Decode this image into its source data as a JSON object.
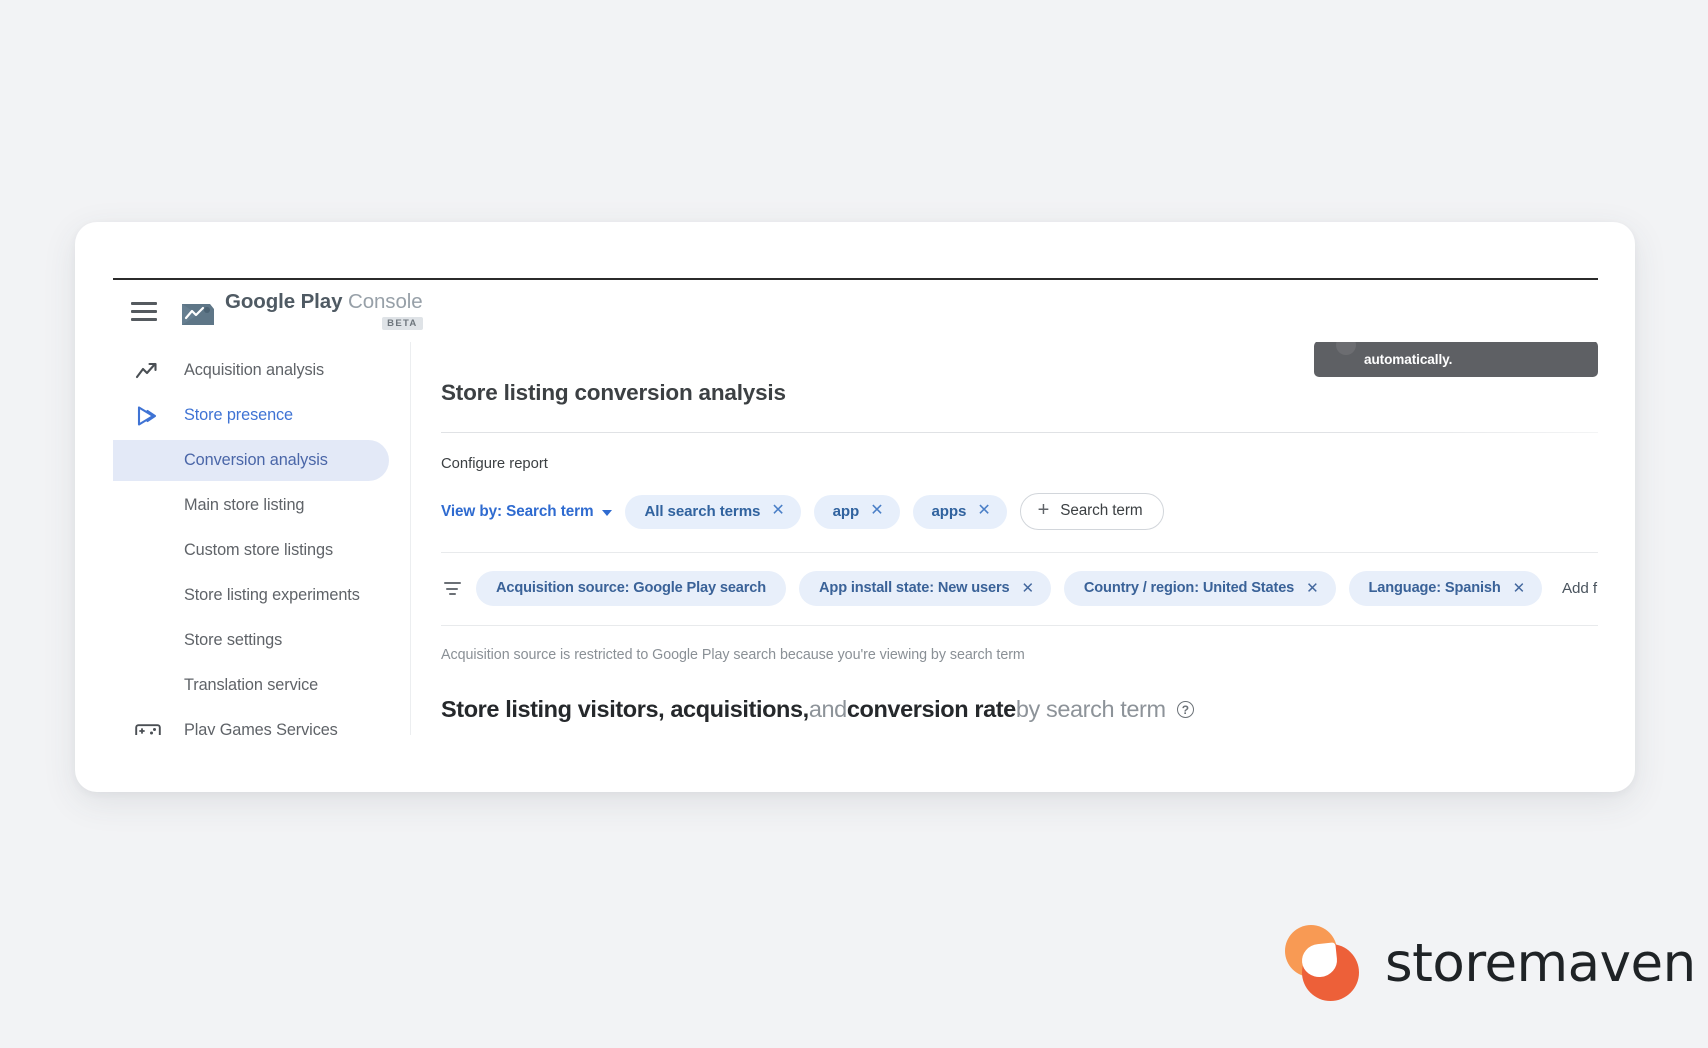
{
  "appbar": {
    "menu_icon": "hamburger-menu-icon",
    "logo_icon": "google-play-console-logo-icon",
    "brand_primary": "Google Play",
    "brand_secondary": "Console",
    "beta_badge": "BETA"
  },
  "sidebar": {
    "items": [
      {
        "label": "Acquisition analysis",
        "icon": "trend-up-icon",
        "type": "item",
        "active": false
      },
      {
        "label": "Store presence",
        "icon": "play-triangle-icon",
        "type": "section",
        "active": false
      },
      {
        "label": "Conversion analysis",
        "type": "sub",
        "active": true
      },
      {
        "label": "Main store listing",
        "type": "sub",
        "active": false
      },
      {
        "label": "Custom store listings",
        "type": "sub",
        "active": false
      },
      {
        "label": "Store listing experiments",
        "type": "sub",
        "active": false
      },
      {
        "label": "Store settings",
        "type": "sub",
        "active": false
      },
      {
        "label": "Translation service",
        "type": "sub",
        "active": false
      },
      {
        "label": "Play Games Services",
        "icon": "gamepad-icon",
        "type": "item",
        "active": false
      }
    ]
  },
  "main": {
    "page_title": "Store listing conversion analysis",
    "section_label": "Configure report",
    "view_by": {
      "label": "View by: Search term",
      "caret_icon": "chevron-down-icon"
    },
    "term_chips": [
      {
        "label": "All search terms",
        "remove_icon": "close-icon"
      },
      {
        "label": "app",
        "remove_icon": "close-icon"
      },
      {
        "label": "apps",
        "remove_icon": "close-icon"
      }
    ],
    "add_term_button": {
      "label": "Search term",
      "plus_icon": "plus-icon"
    },
    "filter_icon": "filter-icon",
    "filter_chips": [
      {
        "label": "Acquisition source: Google Play search",
        "removable": false
      },
      {
        "label": "App install state: New users",
        "removable": true,
        "remove_icon": "close-icon"
      },
      {
        "label": "Country / region: United States",
        "removable": true,
        "remove_icon": "close-icon"
      },
      {
        "label": "Language: Spanish",
        "removable": true,
        "remove_icon": "close-icon"
      }
    ],
    "add_filter_label": "Add filter",
    "note": "Acquisition source is restricted to Google Play search because you're viewing by search term",
    "chart_heading": {
      "part1": "Store listing visitors, acquisitions,",
      "part2": " and ",
      "part3": "conversion rate",
      "part4": " by search term",
      "help_icon": "help-circle-icon",
      "help_glyph": "?"
    },
    "snackbar": {
      "text": "automatically."
    }
  },
  "branding": {
    "logo_icon": "storemaven-circles-icon",
    "wordmark": "storemaven",
    "accent_light": "#f89a54",
    "accent_dark": "#ed6039"
  },
  "colors": {
    "page_background": "#f2f3f5",
    "chip_background": "#e7effb",
    "chip_text": "#31639f",
    "active_nav_background": "#e3e9f7",
    "link_blue": "#2f6bd0"
  }
}
